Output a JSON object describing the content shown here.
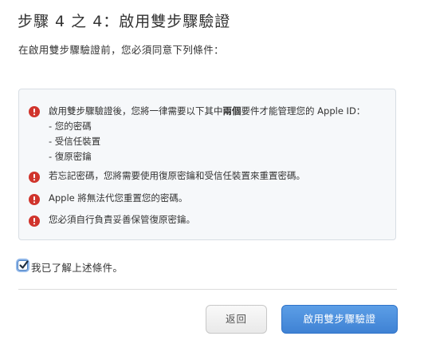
{
  "header": {
    "title": "步驟 4 之 4：啟用雙步驟驗證",
    "subtitle": "在啟用雙步驟驗證前，您必須同意下列條件："
  },
  "terms": {
    "item1": {
      "prefix": "啟用雙步驟驗證後，您將一律需要以下其中",
      "bold": "兩個",
      "suffix": "要件才能管理您的 Apple ID：",
      "sub_items": [
        "- 您的密碼",
        "- 受信任裝置",
        "- 復原密鑰"
      ]
    },
    "item2": "若忘記密碼，您將需要使用復原密鑰和受信任裝置來重置密碼。",
    "item3": "Apple 將無法代您重置您的密碼。",
    "item4": "您必須自行負責妥善保管復原密鑰。",
    "icon": "exclamation-circle-icon",
    "icon_color": "#d0342c"
  },
  "agreement": {
    "label": "我已了解上述條件。",
    "checked": true
  },
  "buttons": {
    "back": "返回",
    "primary": "啟用雙步驟驗證"
  },
  "colors": {
    "primary_button": "#4a8cdb",
    "box_background": "#f6f8fa"
  }
}
